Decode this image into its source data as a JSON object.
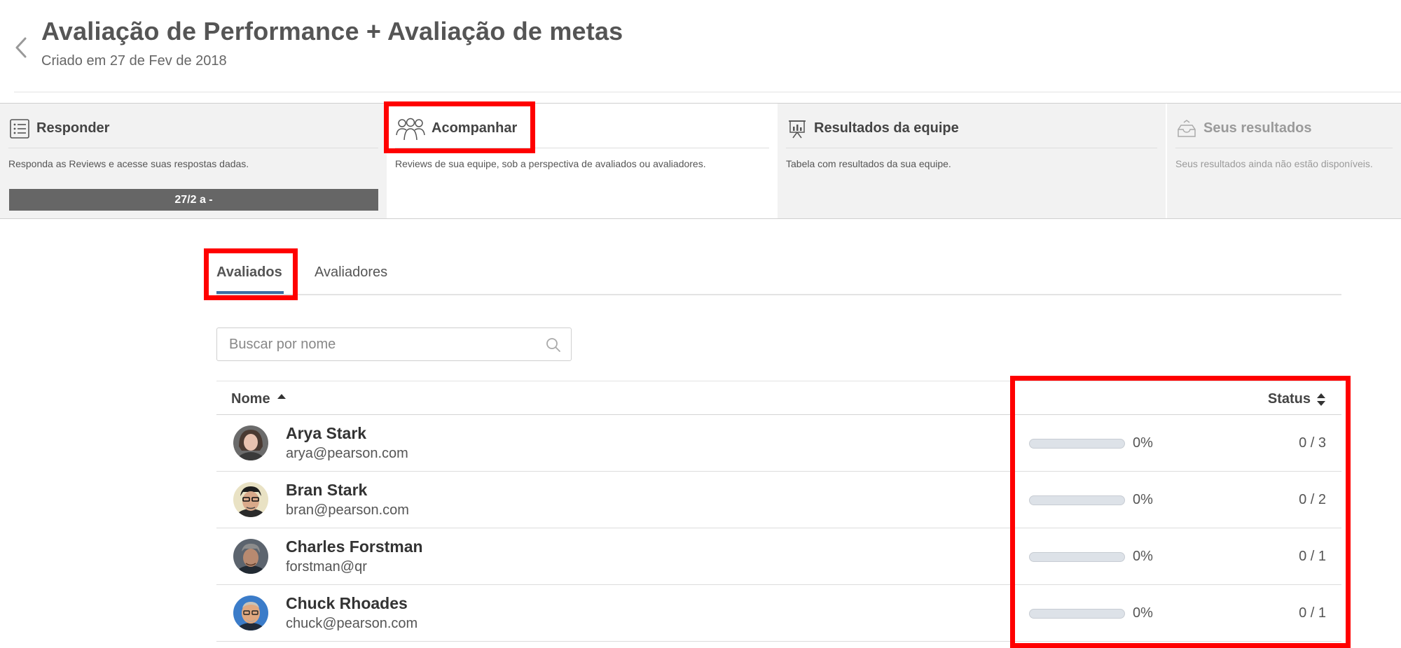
{
  "header": {
    "title": "Avaliação de Performance + Avaliação de metas",
    "subtitle": "Criado em 27 de Fev de 2018"
  },
  "steps": [
    {
      "title": "Responder",
      "description": "Responda as Reviews e acesse suas respostas dadas.",
      "bar_label": "27/2 a -",
      "icon": "list-icon"
    },
    {
      "title": "Acompanhar",
      "description": "Reviews de sua equipe, sob a perspectiva de avaliados ou avaliadores.",
      "icon": "team-icon"
    },
    {
      "title": "Resultados da equipe",
      "description": "Tabela com resultados da sua equipe.",
      "icon": "presentation-chart-icon"
    },
    {
      "title": "Seus resultados",
      "description": "Seus resultados ainda não estão disponíveis.",
      "icon": "inbox-icon"
    }
  ],
  "tabs": [
    {
      "label": "Avaliados",
      "active": true
    },
    {
      "label": "Avaliadores",
      "active": false
    }
  ],
  "search": {
    "placeholder": "Buscar por nome",
    "value": ""
  },
  "table": {
    "columns": {
      "name": "Nome",
      "status": "Status"
    },
    "rows": [
      {
        "name": "Arya Stark",
        "email": "arya@pearson.com",
        "progress": 0,
        "percent": "0%",
        "count": "0 / 3"
      },
      {
        "name": "Bran Stark",
        "email": "bran@pearson.com",
        "progress": 0,
        "percent": "0%",
        "count": "0 / 2"
      },
      {
        "name": "Charles Forstman",
        "email": "forstman@qr",
        "progress": 0,
        "percent": "0%",
        "count": "0 / 1"
      },
      {
        "name": "Chuck Rhoades",
        "email": "chuck@pearson.com",
        "progress": 0,
        "percent": "0%",
        "count": "0 / 1"
      }
    ]
  },
  "colors": {
    "highlight": "#ff0000",
    "tab_underline": "#3a6ea5",
    "progress_track": "#dde2e8",
    "step_bar": "#666666"
  }
}
